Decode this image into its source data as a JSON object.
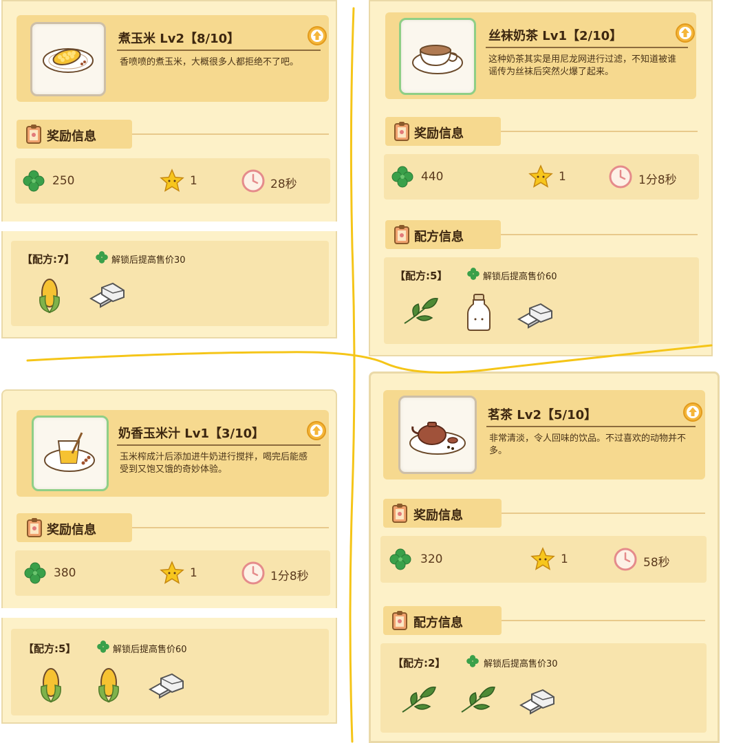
{
  "labels": {
    "reward_section": "奖励信息",
    "recipe_section": "配方信息"
  },
  "items": [
    {
      "name": "煮玉米 Lv2【8/10】",
      "description": "香喷喷的煮玉米，大概很多人都拒绝不了吧。",
      "clover": "250",
      "star": "1",
      "time": "28秒",
      "recipe_label": "【配方:7】",
      "recipe_note": "解锁后提高售价30",
      "ingredients": [
        "corn-icon",
        "sugar-cube-icon"
      ]
    },
    {
      "name": "丝袜奶茶 Lv1【2/10】",
      "description": "这种奶茶其实是用尼龙网进行过滤，不知道被谁谣传为丝袜后突然火爆了起来。",
      "clover": "440",
      "star": "1",
      "time": "1分8秒",
      "recipe_label": "【配方:5】",
      "recipe_note": "解锁后提高售价60",
      "ingredients": [
        "tea-leaf-icon",
        "milk-bottle-icon",
        "sugar-cube-icon"
      ]
    },
    {
      "name": "奶香玉米汁 Lv1【3/10】",
      "description": "玉米榨成汁后添加进牛奶进行搅拌，喝完后能感受到又饱又饿的奇妙体验。",
      "clover": "380",
      "star": "1",
      "time": "1分8秒",
      "recipe_label": "【配方:5】",
      "recipe_note": "解锁后提高售价60",
      "ingredients": [
        "corn-icon",
        "corn-icon",
        "sugar-cube-icon"
      ]
    },
    {
      "name": "茗茶 Lv2【5/10】",
      "description": "非常清淡，令人回味的饮品。不过喜欢的动物并不多。",
      "clover": "320",
      "star": "1",
      "time": "58秒",
      "recipe_label": "【配方:2】",
      "recipe_note": "解锁后提高售价30",
      "ingredients": [
        "tea-leaf-icon",
        "tea-leaf-icon",
        "sugar-cube-icon"
      ]
    }
  ],
  "colors": {
    "panel": "#fdf1c8",
    "card": "#f6d98f",
    "divider_stroke": "#f5c518",
    "clover": "#3aa04a",
    "star": "#f7c61d",
    "clock": "#e58b8b"
  }
}
